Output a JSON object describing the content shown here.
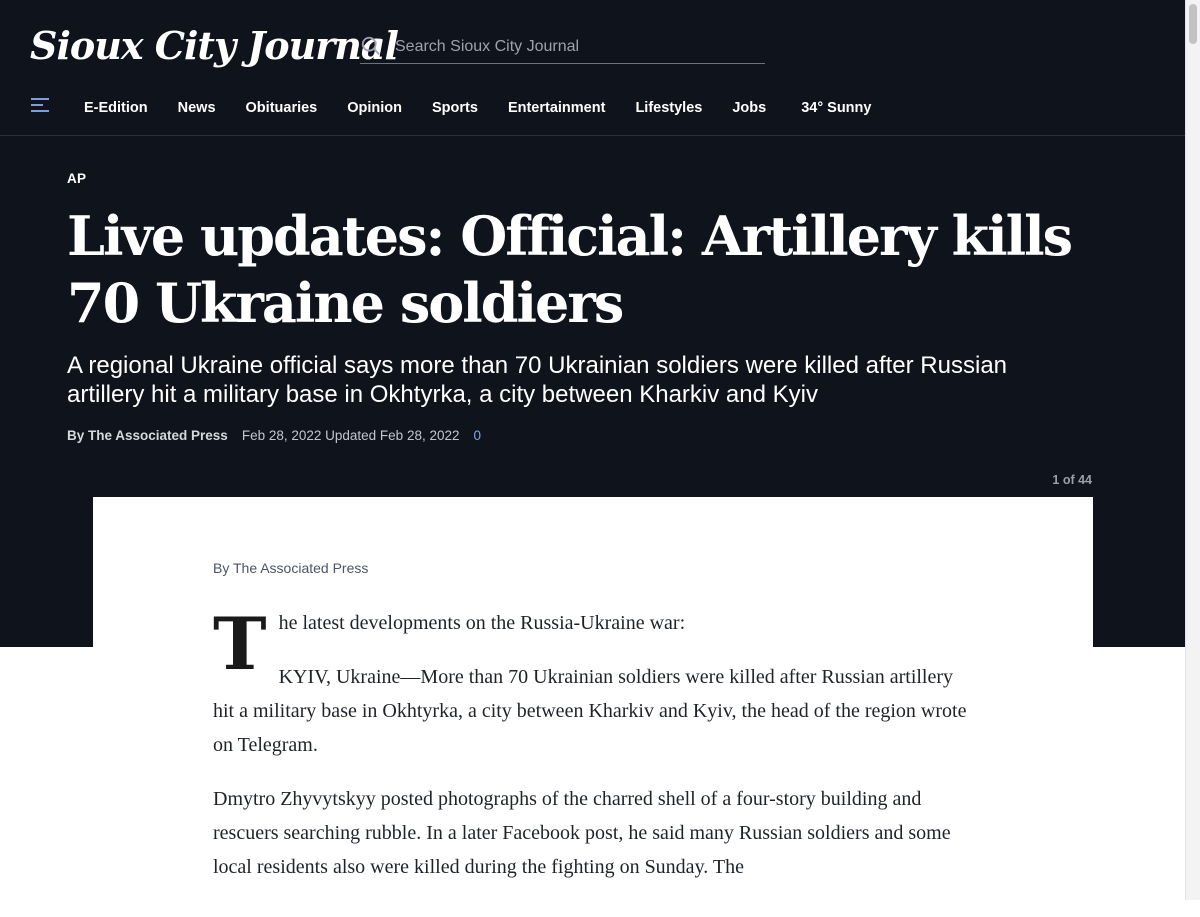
{
  "site": {
    "logo_text": "Sioux City Journal"
  },
  "search": {
    "placeholder": "Search Sioux City Journal"
  },
  "nav": {
    "items": [
      "E-Edition",
      "News",
      "Obituaries",
      "Opinion",
      "Sports",
      "Entertainment",
      "Lifestyles",
      "Jobs"
    ],
    "weather": "34° Sunny"
  },
  "article": {
    "kicker": "AP",
    "headline": "Live updates: Official: Artillery kills 70 Ukraine soldiers",
    "subhead": "A regional Ukraine official says more than 70 Ukrainian soldiers were killed after Russian artillery hit a military base in Okhtyrka, a city between Kharkiv and Kyiv",
    "byline": "By The Associated Press",
    "date_line": "Feb 28, 2022 Updated Feb 28, 2022",
    "comment_count": "0",
    "gallery_count": "1 of 44",
    "card_byline": "By The Associated Press",
    "dropcap": "T",
    "paragraphs": [
      "he latest developments on the Russia-Ukraine war:",
      "KYIV, Ukraine—More than 70 Ukrainian soldiers were killed after Russian artillery hit a military base in Okhtyrka, a city between Kharkiv and Kyiv, the head of the region wrote on Telegram.",
      "Dmytro Zhyvytskyy posted photographs of the charred shell of a four-story building and rescuers searching rubble. In a later Facebook post, he said many Russian soldiers and some local residents also were killed during the fighting on Sunday. The"
    ]
  },
  "colors": {
    "header_bg": "#0f131b",
    "accent_link": "#7aa6f2",
    "menu_icon": "#7d9cd9"
  }
}
